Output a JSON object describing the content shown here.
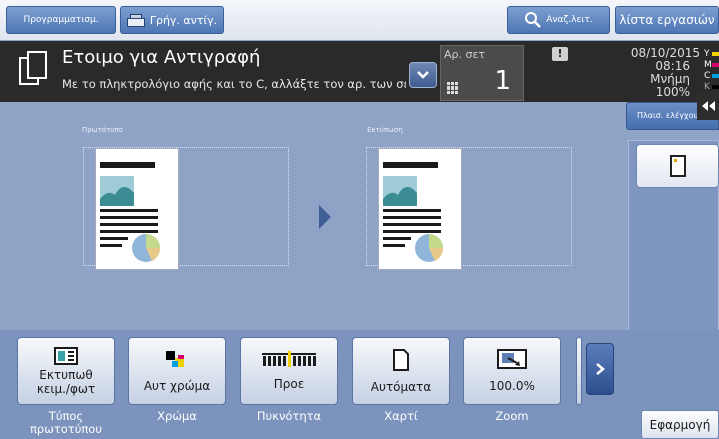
{
  "toolbar": {
    "programs": "Προγραμματισμ.",
    "quick_copy": "Γρήγ. αντίγ.",
    "search_function": "Αναζ.λειτ.",
    "job_list": "λίστα εργασιών"
  },
  "status": {
    "title": "Ετοιμο για Αντιγραφή",
    "message": "Με το πληκτρολόγιο αφής και το C, αλλάξτε τον αρ. των σετ.",
    "sets_label": "Αρ. σετ",
    "sets_value": "1",
    "date": "08/10/2015",
    "time": "08:16",
    "memory_label": "Μνήμη",
    "memory_value": "100%",
    "toner_letters": [
      "Y",
      "M",
      "C",
      "K"
    ]
  },
  "colors": {
    "accent": "#4d76b6",
    "toner_y": "#f2d200",
    "toner_m": "#d8006f",
    "toner_c": "#00a0e0",
    "toner_k": "#000000"
  },
  "side": {
    "control_panel": "Πλαισ. ελέγχου",
    "collapse_icon": "double-chevron-left-icon"
  },
  "preview": {
    "original_caption": "Πρωτότυπο",
    "output_caption": "Εκτύπωση"
  },
  "settings": [
    {
      "id": "original-type",
      "icon": "original-type-icon",
      "value": "Εκτυπωθ κειμ./φωτ",
      "label": "Τύπος πρωτοτύπου"
    },
    {
      "id": "color",
      "icon": "color-squares-icon",
      "value": "Αυτ χρώμα",
      "label": "Χρώμα"
    },
    {
      "id": "density",
      "icon": "density-gauge-icon",
      "value": "Προε",
      "label": "Πυκνότητα"
    },
    {
      "id": "paper",
      "icon": "paper-icon",
      "value": "Αυτόματα",
      "label": "Χαρτί"
    },
    {
      "id": "zoom",
      "icon": "zoom-icon",
      "value": "100.0%",
      "label": "Zoom"
    }
  ],
  "apply_label": "Εφαρμογή"
}
